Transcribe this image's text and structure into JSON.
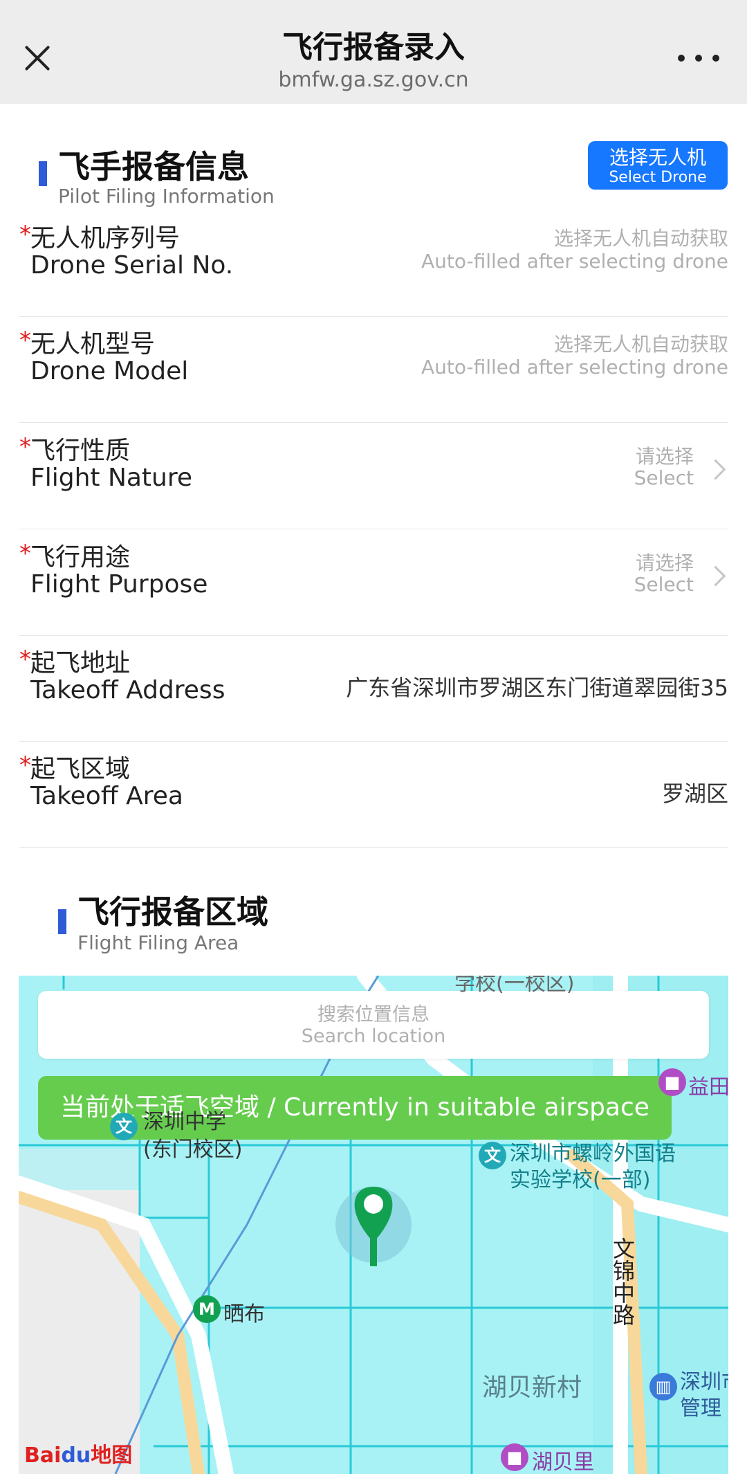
{
  "topbar": {
    "title": "飞行报备录入",
    "subtitle": "bmfw.ga.sz.gov.cn",
    "close_icon": "close-icon",
    "more_icon": "more-icon"
  },
  "pilot_section": {
    "title_cn": "飞手报备信息",
    "title_en": "Pilot Filing Information",
    "select_drone_cn": "选择无人机",
    "select_drone_en": "Select Drone"
  },
  "fields": {
    "required_mark": "*",
    "serial": {
      "label_cn": "无人机序列号",
      "label_en": "Drone Serial No.",
      "placeholder_cn": "选择无人机自动获取",
      "placeholder_en": "Auto-filled after selecting drone"
    },
    "model": {
      "label_cn": "无人机型号",
      "label_en": "Drone Model",
      "placeholder_cn": "选择无人机自动获取",
      "placeholder_en": "Auto-filled after selecting drone"
    },
    "nature": {
      "label_cn": "飞行性质",
      "label_en": "Flight Nature",
      "placeholder_cn": "请选择",
      "placeholder_en": "Select"
    },
    "purpose": {
      "label_cn": "飞行用途",
      "label_en": "Flight Purpose",
      "placeholder_cn": "请选择",
      "placeholder_en": "Select"
    },
    "address": {
      "label_cn": "起飞地址",
      "label_en": "Takeoff Address",
      "value": "广东省深圳市罗湖区东门街道翠园街35"
    },
    "area": {
      "label_cn": "起飞区域",
      "label_en": "Takeoff Area",
      "value": "罗湖区"
    }
  },
  "area_section": {
    "title_cn": "飞行报备区域",
    "title_en": "Flight Filing Area"
  },
  "map": {
    "search_placeholder_cn": "搜索位置信息",
    "search_placeholder_en": "Search location",
    "status": "当前处于适飞空域 / Currently in suitable airspace",
    "labels": {
      "school_top": "学校(一校区)",
      "yitian": "益田假",
      "shenzhen_middle_1": "深圳中学",
      "shenzhen_middle_2": "(东门校区)",
      "luoling_1": "深圳市螺岭外国语",
      "luoling_2": "实验学校(一部)",
      "wenjin_road": "文锦中路",
      "shibu": "晒布",
      "hubei_village": "湖贝新村",
      "shenzhen_mgmt_1": "深圳市",
      "shenzhen_mgmt_2": "管理",
      "hubeili": "湖贝里",
      "baidu_logo": "Baidu地图"
    },
    "colors": {
      "airspace": "#a8f2f5",
      "status_green": "#66cc4e",
      "marker_green": "#12a150"
    }
  }
}
